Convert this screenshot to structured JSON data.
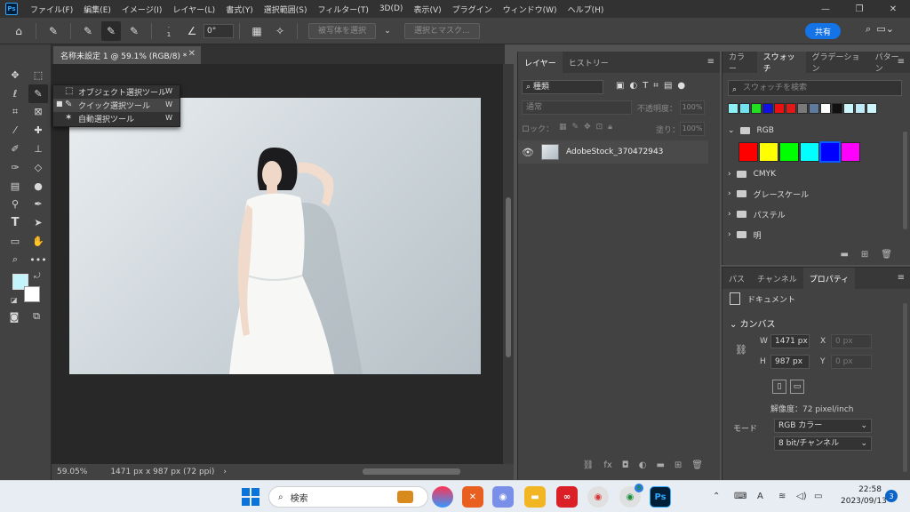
{
  "menubar": {
    "logo": "Ps",
    "items": [
      "ファイル(F)",
      "編集(E)",
      "イメージ(I)",
      "レイヤー(L)",
      "書式(Y)",
      "選択範囲(S)",
      "フィルター(T)",
      "3D(D)",
      "表示(V)",
      "プラグイン",
      "ウィンドウ(W)",
      "ヘルプ(H)"
    ]
  },
  "optionsbar": {
    "brush_size": "1",
    "angle": "0°",
    "select_subject_label": "被写体を選択",
    "select_mask_label": "選択とマスク...",
    "share_label": "共有"
  },
  "document": {
    "tab_title": "名称未設定 1 @ 59.1% (RGB/8) *",
    "zoom": "59.05%",
    "doc_info": "1471 px x 987 px (72 ppi)"
  },
  "flyout": {
    "items": [
      {
        "label": "オブジェクト選択ツール",
        "key": "W"
      },
      {
        "label": "クイック選択ツール",
        "key": "W"
      },
      {
        "label": "自動選択ツール",
        "key": "W"
      }
    ]
  },
  "colors": {
    "foreground": "#c4f4fb",
    "background": "#ffffff"
  },
  "layers": {
    "tabs": [
      "レイヤー",
      "ヒストリー"
    ],
    "filter": "種類",
    "blend_mode": "通常",
    "opacity_label": "不透明度：",
    "opacity_value": "100%",
    "lock_label": "ロック：",
    "fill_label": "塗り：",
    "fill_value": "100%",
    "layer_name": "AdobeStock_370472943"
  },
  "swatches": {
    "tabs": [
      "カラー",
      "スウォッチ",
      "グラデーション",
      "パターン"
    ],
    "search_placeholder": "スウォッチを検索",
    "recent": [
      "#8ef0f5",
      "#6fe3f0",
      "#22e022",
      "#1010e0",
      "#e81010",
      "#e01818",
      "#7a7a7a",
      "#5e7a9c",
      "#ffffff",
      "#101010",
      "#ccf6fa",
      "#bfe9f8",
      "#cdf4fb"
    ],
    "groups": [
      "RGB",
      "CMYK",
      "グレースケール",
      "パステル",
      "明"
    ],
    "rgb_swatches": [
      "#ff0000",
      "#ffff00",
      "#00ff00",
      "#00ffff",
      "#0000ff",
      "#ff00ff"
    ]
  },
  "properties": {
    "tabs": [
      "パス",
      "チャンネル",
      "プロパティ"
    ],
    "doc_label": "ドキュメント",
    "section": "カンバス",
    "w_label": "W",
    "w_value": "1471 px",
    "h_label": "H",
    "h_value": "987 px",
    "x_label": "X",
    "x_placeholder": "0 px",
    "y_label": "Y",
    "y_placeholder": "0 px",
    "resolution": "解像度：72 pixel/inch",
    "mode_label": "モード",
    "mode_value": "RGB カラー",
    "bit_value": "8 bit/チャンネル"
  },
  "taskbar": {
    "search_label": "検索",
    "time": "22:58",
    "date": "2023/09/13",
    "notifications": "3",
    "ime_label": "A",
    "badge": "8"
  }
}
